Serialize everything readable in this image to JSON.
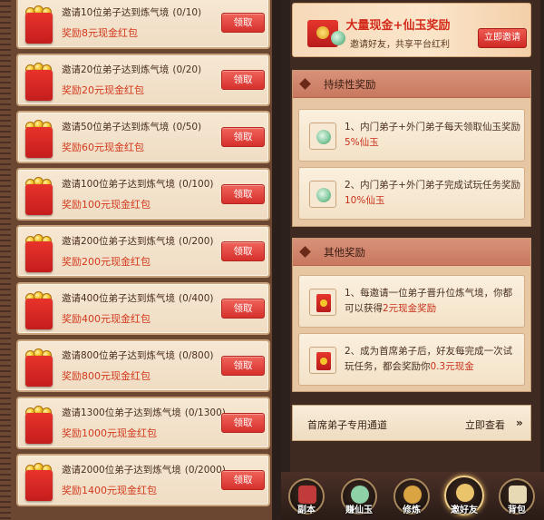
{
  "tasks": [
    {
      "title": "邀请10位弟子达到炼气境",
      "progress": "(0/10)",
      "reward": "奖励8元现金红包",
      "button": "领取"
    },
    {
      "title": "邀请20位弟子达到炼气境",
      "progress": "(0/20)",
      "reward": "奖励20元现金红包",
      "button": "领取"
    },
    {
      "title": "邀请50位弟子达到炼气境",
      "progress": "(0/50)",
      "reward": "奖励60元现金红包",
      "button": "领取"
    },
    {
      "title": "邀请100位弟子达到炼气境",
      "progress": "(0/100)",
      "reward": "奖励100元现金红包",
      "button": "领取"
    },
    {
      "title": "邀请200位弟子达到炼气境",
      "progress": "(0/200)",
      "reward": "奖励200元现金红包",
      "button": "领取"
    },
    {
      "title": "邀请400位弟子达到炼气境",
      "progress": "(0/400)",
      "reward": "奖励400元现金红包",
      "button": "领取"
    },
    {
      "title": "邀请800位弟子达到炼气境",
      "progress": "(0/800)",
      "reward": "奖励800元现金红包",
      "button": "领取"
    },
    {
      "title": "邀请1300位弟子达到炼气境",
      "progress": "(0/1300)",
      "reward": "奖励1000元现金红包",
      "button": "领取"
    },
    {
      "title": "邀请2000位弟子达到炼气境",
      "progress": "(0/2000)",
      "reward": "奖励1400元现金红包",
      "button": "领取"
    }
  ],
  "banner": {
    "title": "大量现金+仙玉奖励",
    "subtitle": "邀请好友，共享平台红利",
    "button": "立即邀请"
  },
  "continuous": {
    "title": "持续性奖励",
    "items": [
      {
        "text": "1、内门弟子+外门弟子每天领取仙玉奖励",
        "highlight": "5%仙玉"
      },
      {
        "text": "2、内门弟子+外门弟子完成试玩任务奖励",
        "highlight": "10%仙玉"
      }
    ]
  },
  "other": {
    "title": "其他奖励",
    "items": [
      {
        "text": "1、每邀请一位弟子晋升位炼气境，你都可以获得",
        "highlight": "2元现金奖励"
      },
      {
        "text": "2、成为首席弟子后，好友每完成一次试玩任务，都会奖励你",
        "highlight": "0.3元现金"
      }
    ]
  },
  "chief": {
    "label": "首席弟子专用通道",
    "link": "立即查看",
    "chevron": "»"
  },
  "nav": [
    {
      "label": "副本",
      "icon": "dungeon-icon",
      "color": "#c23b3b"
    },
    {
      "label": "赚仙玉",
      "icon": "jade-icon",
      "color": "#8fd1a6"
    },
    {
      "label": "修炼",
      "icon": "cultivate-icon",
      "color": "#d9a441"
    },
    {
      "label": "邀好友",
      "icon": "invite-icon",
      "color": "#e9c46a"
    },
    {
      "label": "背包",
      "icon": "bag-icon",
      "color": "#e8d9b5"
    }
  ]
}
